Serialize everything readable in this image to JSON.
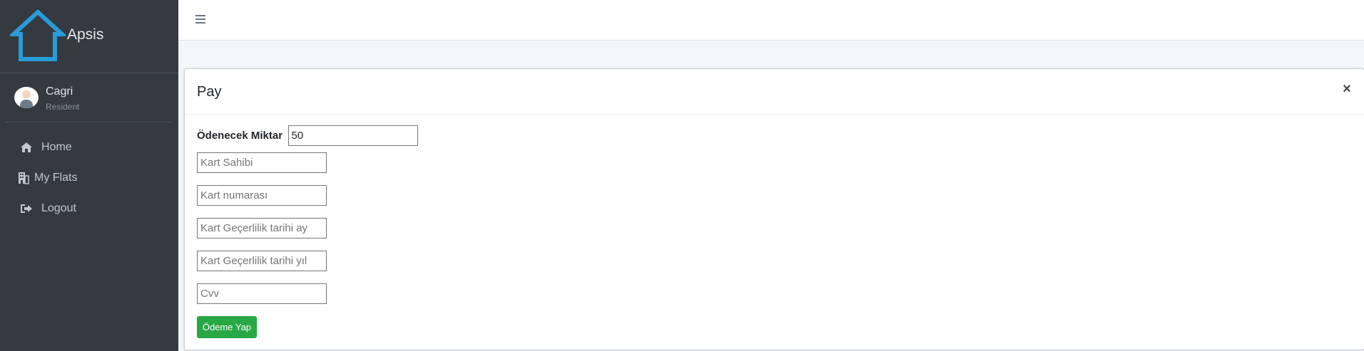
{
  "brand": {
    "name": "Apsis",
    "logo_icon": "house-outline-icon",
    "accent": "#2a9bd8"
  },
  "user": {
    "name": "Cagri",
    "role": "Resident",
    "avatar_icon": "user-avatar"
  },
  "nav": {
    "items": [
      {
        "label": "Home",
        "icon": "home-icon"
      },
      {
        "label": "My Flats",
        "icon": "building-icon"
      },
      {
        "label": "Logout",
        "icon": "sign-out-icon"
      }
    ]
  },
  "topbar": {
    "menu_icon": "hamburger-icon"
  },
  "modal": {
    "title": "Pay",
    "close_label": "×",
    "amount_label": "Ödenecek Miktar",
    "amount_value": "50",
    "fields": [
      {
        "placeholder": "Kart Sahibi"
      },
      {
        "placeholder": "Kart numarası"
      },
      {
        "placeholder": "Kart Geçerlilik tarihi ay"
      },
      {
        "placeholder": "Kart Geçerlilik tarihi yıl"
      },
      {
        "placeholder": "Cvv"
      }
    ],
    "submit_label": "Ödeme Yap",
    "submit_color": "#28a745"
  }
}
